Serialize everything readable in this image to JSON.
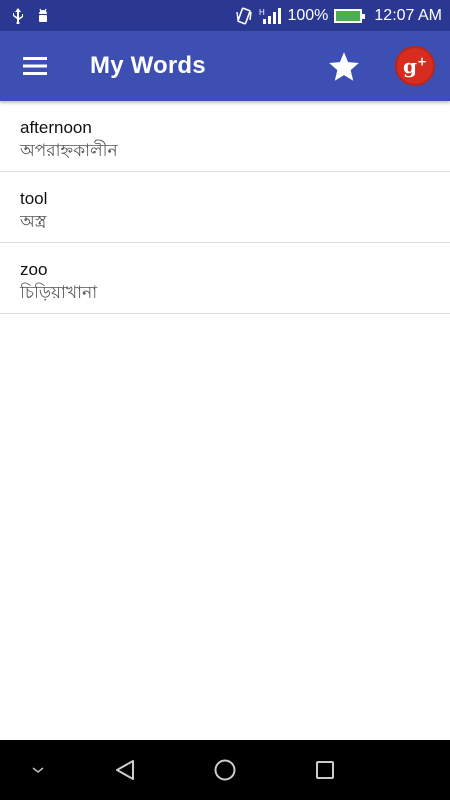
{
  "status_bar": {
    "left_icons": [
      "usb-icon",
      "android-debug-icon"
    ],
    "right_icons": [
      "vibrate-icon",
      "signal-h-icon",
      "battery-charging-icon"
    ],
    "battery": "100%",
    "time": "12:07 AM"
  },
  "app_bar": {
    "title": "My Words",
    "menu_icon": "hamburger-menu-icon",
    "favorites_icon": "star-icon",
    "google_plus_label": "g"
  },
  "words": [
    {
      "word": "afternoon",
      "meaning": "অপরাহ্নকালীন"
    },
    {
      "word": "tool",
      "meaning": "অস্ত্র"
    },
    {
      "word": "zoo",
      "meaning": "চিড়িয়াখানা"
    }
  ],
  "nav_bar": {
    "icons": [
      "chevron-down-icon",
      "back-icon",
      "home-icon",
      "recents-icon"
    ]
  },
  "colors": {
    "status_bar": "#2a3891",
    "app_bar": "#3d4fb3",
    "google_plus": "#d62d20",
    "nav_bar": "#000000"
  }
}
